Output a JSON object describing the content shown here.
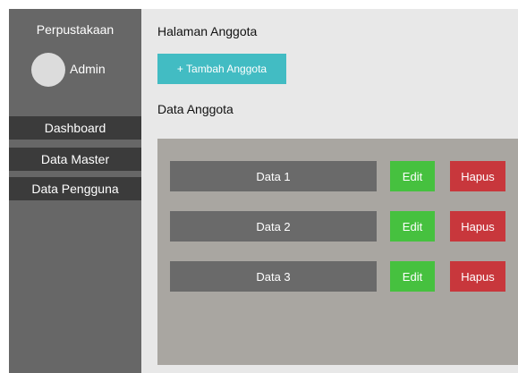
{
  "sidebar": {
    "brand": "Perpustakaan",
    "user_name": "Admin",
    "items": [
      {
        "label": "Dashboard"
      },
      {
        "label": "Data Master"
      },
      {
        "label": "Data Pengguna"
      }
    ]
  },
  "main": {
    "title": "Halaman Anggota",
    "add_button_label": "+ Tambah Anggota",
    "section_title": "Data Anggota",
    "rows": [
      {
        "label": "Data 1",
        "edit_label": "Edit",
        "delete_label": "Hapus"
      },
      {
        "label": "Data 2",
        "edit_label": "Edit",
        "delete_label": "Hapus"
      },
      {
        "label": "Data 3",
        "edit_label": "Edit",
        "delete_label": "Hapus"
      }
    ]
  },
  "colors": {
    "sidebar": "#676767",
    "nav_item": "#3b3b3b",
    "content_bg": "#e8e8e8",
    "panel": "#a9a6a1",
    "accent_add": "#42bcc3",
    "edit": "#46c13f",
    "delete": "#c8373c"
  }
}
